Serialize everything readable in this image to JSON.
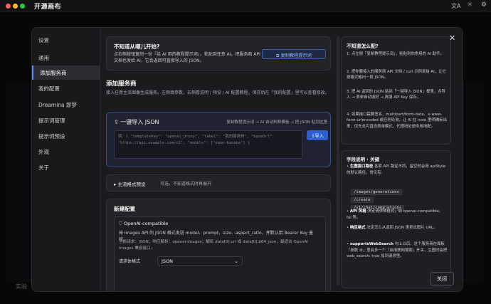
{
  "app": {
    "title": "开源画布",
    "icons": [
      "translate-icon",
      "sun-icon",
      "gear-icon"
    ]
  },
  "sidebar": {
    "title": "设置",
    "items": [
      {
        "label": "通用"
      },
      {
        "label": "添加服务商"
      },
      {
        "label": "我的配置"
      },
      {
        "label": "Dreamina 即梦"
      },
      {
        "label": "提示词管理"
      },
      {
        "label": "提示词预设"
      },
      {
        "label": "外观"
      },
      {
        "label": "关于"
      }
    ],
    "active": 1
  },
  "hint": {
    "title": "不知道从哪儿开始?",
    "text": "点右侧按钮复制一份「给 AI 用的教程提示词」，粘贴到任意 AI。把服务商 API 文档也发给 AI，它会返回可直接导入的 JSON。",
    "button": "复制教程提示词"
  },
  "add": {
    "title": "添加服务商",
    "desc": "接入任意主流图像生成服务。左侧填参数，右侧看说明 / 预设 / AI 配置教程。保存后在「我的配置」里可以查看修改。"
  },
  "import": {
    "title": "一键导入 JSON",
    "flow": "复制教程提示词 → AI 自动判断模板 → 把 JSON 贴到这里",
    "placeholder": "例：{ \"templateKey\": \"openai_proxy\", \"label\": \"我的服务商\", \"baseUrl\": \"https://api.example.com/v1\", \"models\": [\"nano-banana\"] }",
    "button": "导入"
  },
  "presets": {
    "title": "主流格式预设",
    "hint": "可选，不知道格式时再展开"
  },
  "newconf": {
    "title": "新建配置",
    "card_title": "OpenAI-compatible",
    "card_desc": "按 Images API 的 JSON 格式发送 model、prompt、size、aspect_ratio，并默认用 Bearer Key 鉴权。",
    "card_note": "当前请求：JSON；响应解析：openai-images；解析 data[0].url 或 data[0].b64_json，最适合 OpenAI Images 兼容接口。",
    "body_label": "请求体格式",
    "body_value": "JSON"
  },
  "help": {
    "title": "不知道怎么配?",
    "steps": [
      "1. 点左侧「复制教程提示词」，粘贴到你常用的 AI 助手。",
      "2. 把你要接入的服务商 API 文档 / curl 示例发给 AI，让它按格式输出一段 JSON。",
      "3. 把 AI 返回的 JSON 贴到「一键导入 JSON」框里，点导入 → 表单自动填好 → 再填 API Key 保存。",
      "4. 如果接口需要签名、multipart/form-data、x-www-form-urlencoded 或任务轮询，让 AI 在 note 里明确标出来，优先走可直连表单模式，代理地址请专用地配。"
    ]
  },
  "fields": {
    "title": "字段说明 · 关键",
    "items": [
      {
        "name": "生图接口路径",
        "desc": "各家 API 路径不同，留空时会用 apiStyle 的默认路径。常见有:"
      },
      {
        "name": "API 风格",
        "desc": "决定请求体格式，如 openai-compatible、fal 等。"
      },
      {
        "name": "响应格式",
        "desc": "决定怎么从返回 JSON 里拿出图片 URL。"
      },
      {
        "name": "supportsWebSearch",
        "desc": "勾上以后，这个服务商在面板「参数 ⚙」里会多一个「启用联网搜索」开关，生图时会把 web_search: true 加到请求里。"
      }
    ],
    "paths": [
      "/images/generations",
      "/create",
      "/v1/chat/completions"
    ]
  },
  "close": "关闭",
  "bg": {
    "bottom_text": "实验"
  }
}
